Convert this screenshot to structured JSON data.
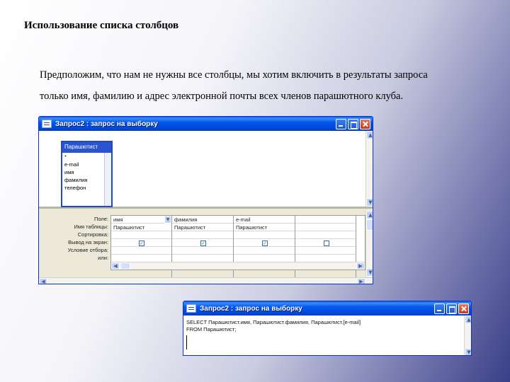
{
  "slide": {
    "title": "Использование списка столбцов",
    "para_line1": "Предположим, что нам не нужны все столбцы, мы хотим включить в результаты запроса",
    "para_line2": "только имя, фамилию и адрес электронной почты всех членов парашютного клуба."
  },
  "window1": {
    "title": "Запрос2 : запрос на выборку",
    "field_list": {
      "table_name": "Парашютист",
      "fields": [
        "*",
        "e-mail",
        "имя",
        "фамилия",
        "телефон"
      ]
    },
    "grid": {
      "row_labels": [
        "Поле:",
        "Имя таблицы:",
        "Сортировка:",
        "Вывод на экран:",
        "Условие отбора:",
        "или:"
      ],
      "columns": [
        {
          "field": "имя",
          "table": "Парашютист",
          "show": true
        },
        {
          "field": "фамилия",
          "table": "Парашютист",
          "show": true
        },
        {
          "field": "e-mail",
          "table": "Парашютист",
          "show": true
        },
        {
          "field": "",
          "table": "",
          "show": false
        }
      ]
    }
  },
  "window2": {
    "title": "Запрос2 : запрос на выборку",
    "sql_line1": "SELECT Парашютист.имя, Парашютист.фамилия, Парашютист.[e-mail]",
    "sql_line2": "FROM Парашютист;"
  },
  "icons": [
    "app-icon",
    "minimize-icon",
    "maximize-icon",
    "close-icon",
    "checkbox-icon",
    "dropdown-arrow-icon",
    "scroll-up-icon",
    "scroll-down-icon",
    "scroll-left-icon",
    "scroll-right-icon"
  ],
  "colors": {
    "titlebar": "#0058ee",
    "window_bg": "#ece9d8",
    "close_button": "#c63a1b"
  }
}
